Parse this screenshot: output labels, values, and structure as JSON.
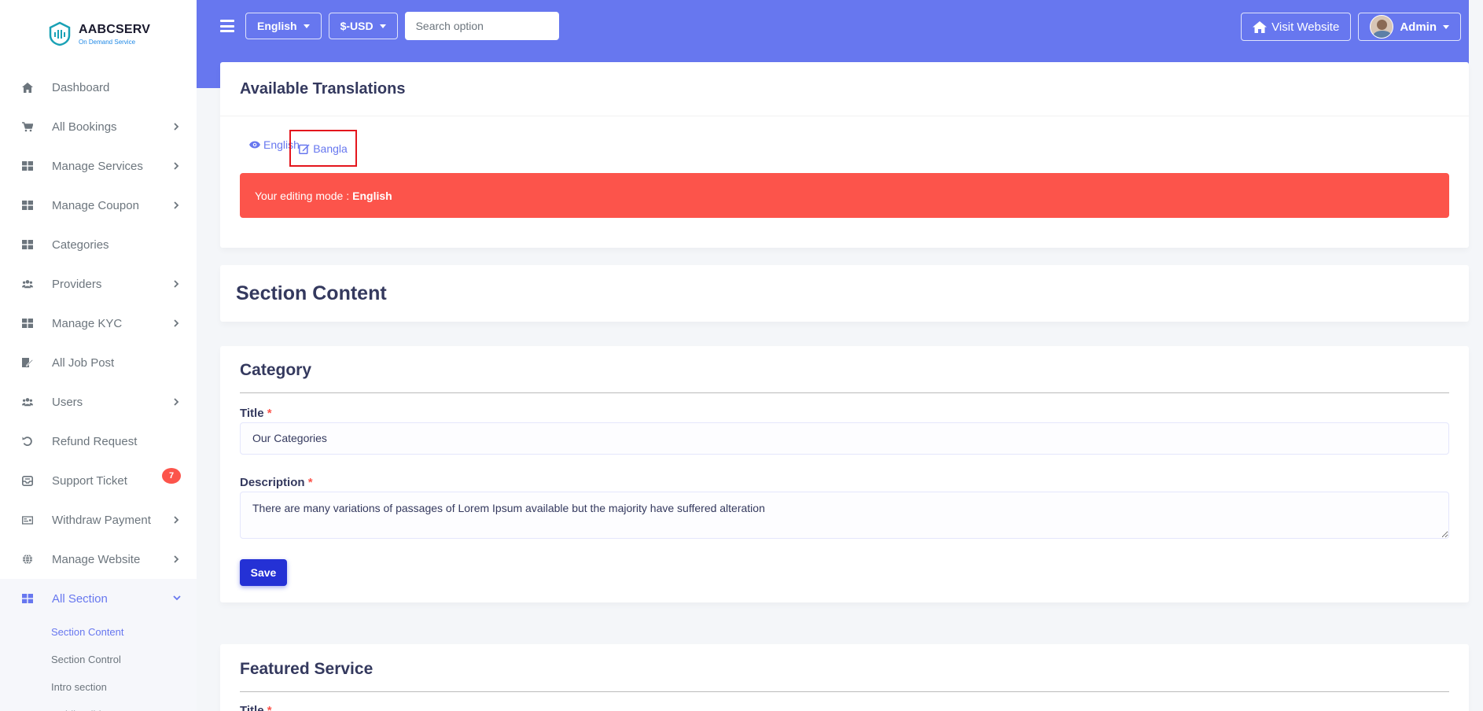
{
  "brand": {
    "name": "AABCSERV",
    "tagline": "On Demand Service"
  },
  "sidebar": {
    "items": [
      {
        "label": "Dashboard",
        "icon": "home-icon",
        "chevron": false
      },
      {
        "label": "All Bookings",
        "icon": "cart-icon",
        "chevron": true
      },
      {
        "label": "Manage Services",
        "icon": "grid-icon",
        "chevron": true
      },
      {
        "label": "Manage Coupon",
        "icon": "grid-icon",
        "chevron": true
      },
      {
        "label": "Categories",
        "icon": "grid-icon",
        "chevron": false
      },
      {
        "label": "Providers",
        "icon": "users-icon",
        "chevron": true
      },
      {
        "label": "Manage KYC",
        "icon": "grid-icon",
        "chevron": true
      },
      {
        "label": "All Job Post",
        "icon": "edit-doc-icon",
        "chevron": false
      },
      {
        "label": "Users",
        "icon": "users-icon",
        "chevron": true
      },
      {
        "label": "Refund Request",
        "icon": "undo-icon",
        "chevron": false
      },
      {
        "label": "Support Ticket",
        "icon": "inbox-icon",
        "badge": "7"
      },
      {
        "label": "Withdraw Payment",
        "icon": "money-icon",
        "chevron": true
      },
      {
        "label": "Manage Website",
        "icon": "globe-icon",
        "chevron": true
      },
      {
        "label": "All Section",
        "icon": "grid-icon",
        "chevron": true,
        "active": true
      }
    ],
    "submenu": [
      {
        "label": "Section Content",
        "active": true
      },
      {
        "label": "Section Control"
      },
      {
        "label": "Intro section"
      },
      {
        "label": "Mobile Slider"
      }
    ]
  },
  "topbar": {
    "language": "English",
    "currency": "$-USD",
    "search_placeholder": "Search option",
    "visit_website": "Visit Website",
    "admin": "Admin"
  },
  "translations": {
    "title": "Available Translations",
    "languages": [
      "English",
      "Bangla"
    ],
    "alert_prefix": "Your editing mode :",
    "alert_mode": "English"
  },
  "section_content": {
    "title": "Section Content"
  },
  "category": {
    "title": "Category",
    "title_label": "Title",
    "title_value": "Our Categories",
    "description_label": "Description",
    "description_value": "There are many variations of passages of Lorem Ipsum available but the majority have suffered alteration",
    "save_label": "Save",
    "required_mark": "*"
  },
  "featured": {
    "title": "Featured Service",
    "title_label": "Title",
    "required_mark": "*"
  },
  "colors": {
    "primary": "#6777ef",
    "danger": "#fc544b",
    "save": "#2431d5"
  }
}
